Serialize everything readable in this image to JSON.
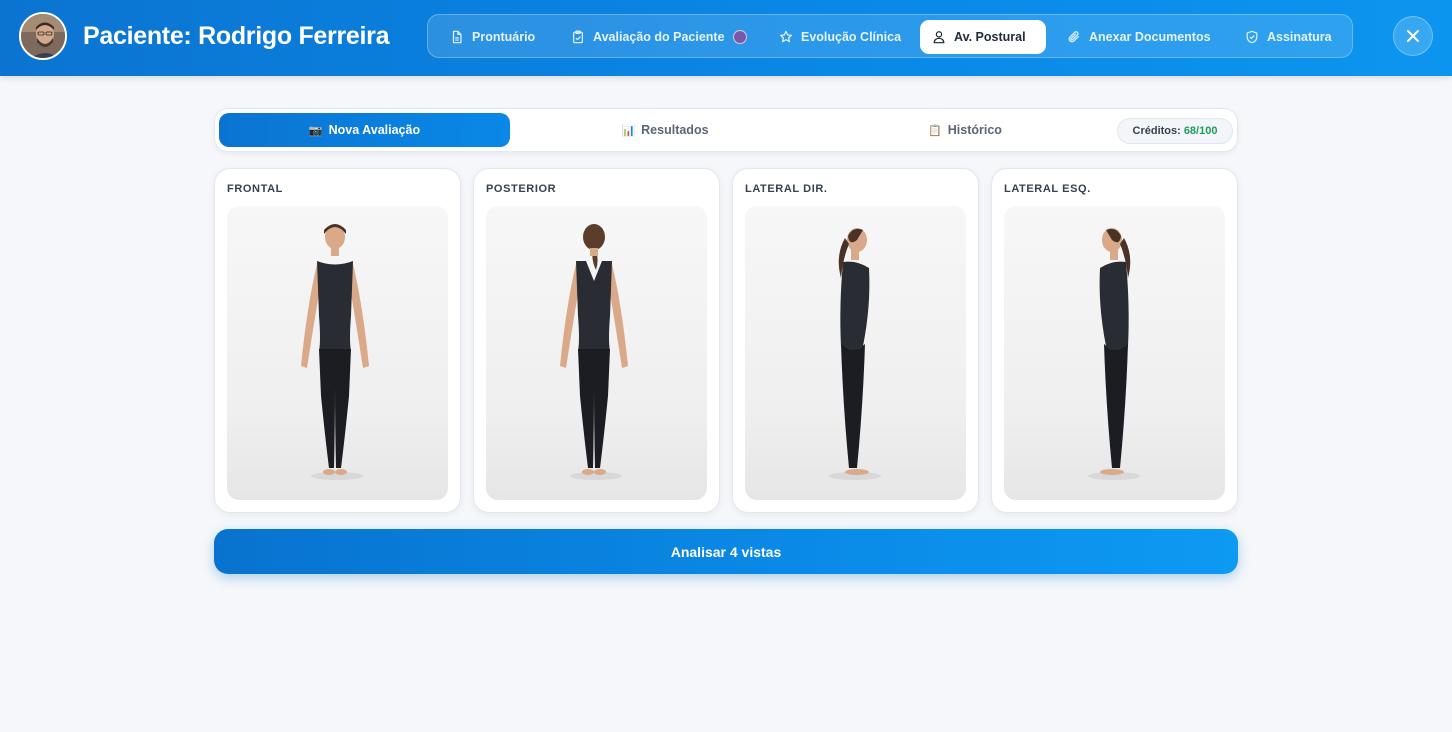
{
  "header": {
    "title": "Paciente: Rodrigo Ferreira",
    "avatar_icon": "user-photo",
    "close_icon": "close-icon"
  },
  "nav": {
    "tabs": [
      {
        "label": "Prontuário",
        "icon": "document-icon",
        "active": false
      },
      {
        "label": "Avaliação do Paciente",
        "icon": "clipboard-check-icon",
        "active": false,
        "badge_color": "#7a58a8"
      },
      {
        "label": "Evolução Clínica",
        "icon": "star-icon",
        "active": false
      },
      {
        "label": "Av. Postural",
        "icon": "user-icon",
        "active": true
      },
      {
        "label": "Anexar Documentos",
        "icon": "paperclip-icon",
        "active": false
      },
      {
        "label": "Assinatura",
        "icon": "shield-check-icon",
        "active": false
      }
    ]
  },
  "subtabs": {
    "items": [
      {
        "emoji": "📷",
        "label": "Nova Avaliação",
        "active": true
      },
      {
        "emoji": "📊",
        "label": "Resultados",
        "active": false
      },
      {
        "emoji": "📋",
        "label": "Histórico",
        "active": false
      }
    ],
    "credits_label": "Créditos:",
    "credits_value": "68/100"
  },
  "views": [
    {
      "label": "FRONTAL",
      "view": "front"
    },
    {
      "label": "POSTERIOR",
      "view": "back"
    },
    {
      "label": "LATERAL DIR.",
      "view": "side-right"
    },
    {
      "label": "LATERAL ESQ.",
      "view": "side-left"
    }
  ],
  "analyze_button": "Analisar 4 vistas",
  "colors": {
    "primary": "#0b74d1",
    "credits_value": "#1e9e5a",
    "background": "#f5f7fa"
  }
}
